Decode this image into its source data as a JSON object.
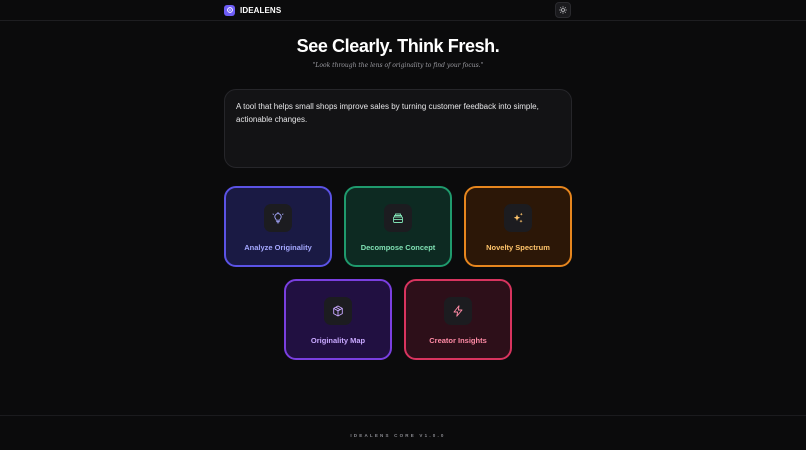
{
  "app": {
    "name": "IDEALENS",
    "accent": "#6d5cf5"
  },
  "header": {
    "logo_icon": "lens-icon",
    "theme_toggle_icon": "sun-icon"
  },
  "hero": {
    "title": "See Clearly. Think Fresh.",
    "quote": "\"Look through the lens of originality to find your focus.\""
  },
  "idea_input": {
    "value": "A tool that helps small shops improve sales by turning customer feedback into simple, actionable changes."
  },
  "actions": [
    {
      "label": "Analyze Originality",
      "icon": "lightbulb-icon",
      "color": "#5b53e6"
    },
    {
      "label": "Decompose Concept",
      "icon": "layers-icon",
      "color": "#1f9a6d"
    },
    {
      "label": "Novelty Spectrum",
      "icon": "sparkles-icon",
      "color": "#e7861e"
    },
    {
      "label": "Originality Map",
      "icon": "cube-icon",
      "color": "#7a3fe0"
    },
    {
      "label": "Creator Insights",
      "icon": "lightning-icon",
      "color": "#d8345f"
    }
  ],
  "footer": {
    "text": "IDEALENS CORE V1.0.0"
  }
}
